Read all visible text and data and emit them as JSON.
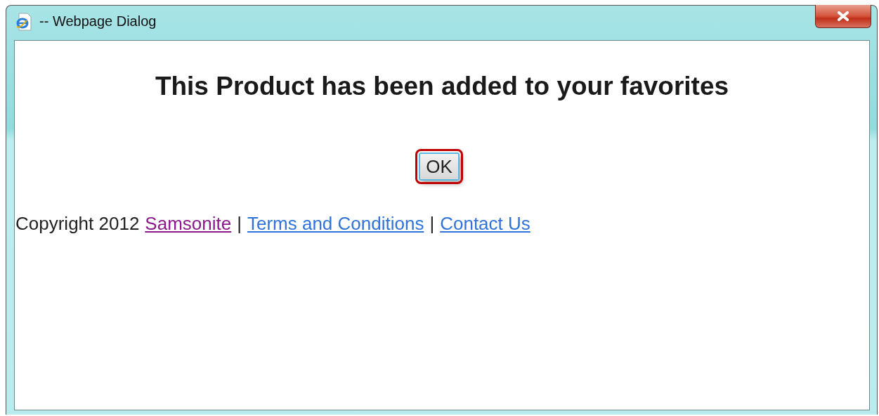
{
  "window": {
    "title": "-- Webpage Dialog"
  },
  "heading": "This Product has been added to your favorites",
  "button": {
    "label": "OK",
    "focused": true
  },
  "footer": [
    {
      "kind": "text",
      "text": "Copyright 2012"
    },
    {
      "kind": "link",
      "text": "Samsonite",
      "visited": true
    },
    {
      "kind": "text",
      "text": "|"
    },
    {
      "kind": "link",
      "text": "Terms and Conditions",
      "visited": false
    },
    {
      "kind": "text",
      "text": "|"
    },
    {
      "kind": "link",
      "text": "Contact Us",
      "visited": false
    }
  ]
}
